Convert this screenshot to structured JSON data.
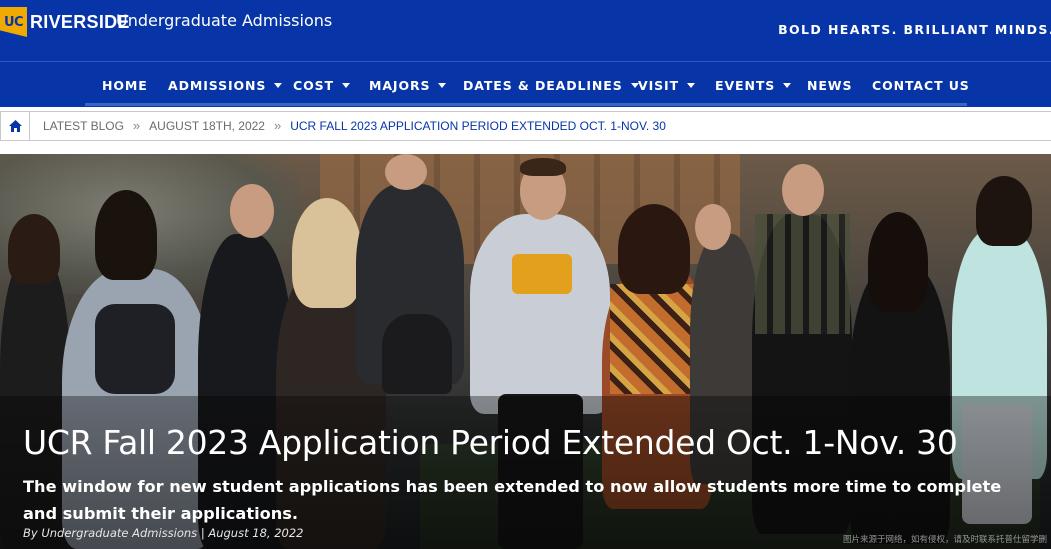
{
  "header": {
    "logo": {
      "uc": "UC",
      "riverside": "RIVERSIDE"
    },
    "site_title": "Undergraduate Admissions",
    "tagline": "BOLD HEARTS. BRILLIANT MINDS."
  },
  "nav": {
    "items": [
      {
        "label": "HOME",
        "dropdown": false
      },
      {
        "label": "ADMISSIONS",
        "dropdown": true
      },
      {
        "label": "COST",
        "dropdown": true
      },
      {
        "label": "MAJORS",
        "dropdown": true
      },
      {
        "label": "DATES & DEADLINES",
        "dropdown": true
      },
      {
        "label": "VISIT",
        "dropdown": true
      },
      {
        "label": "EVENTS",
        "dropdown": true
      },
      {
        "label": "NEWS",
        "dropdown": false
      },
      {
        "label": "CONTACT US",
        "dropdown": false
      }
    ]
  },
  "breadcrumb": {
    "home_icon": "home-icon",
    "items": [
      "LATEST BLOG",
      "AUGUST 18TH, 2022"
    ],
    "separator": "»",
    "current": "UCR FALL 2023 APPLICATION PERIOD EXTENDED OCT. 1-NOV. 30"
  },
  "hero": {
    "title": "UCR Fall 2023 Application Period Extended Oct. 1-Nov. 30",
    "description": "The window for new student applications has been extended to now allow students more time to complete and submit their applications.",
    "byline": "By Undergraduate Admissions | August 18, 2022",
    "watermark": "图片来源于网络，如有侵权，请及时联系托普仕留学删"
  },
  "colors": {
    "brand_blue": "#0735a8",
    "brand_gold": "#f1ab00",
    "breadcrumb_text": "#6b6b6b"
  }
}
